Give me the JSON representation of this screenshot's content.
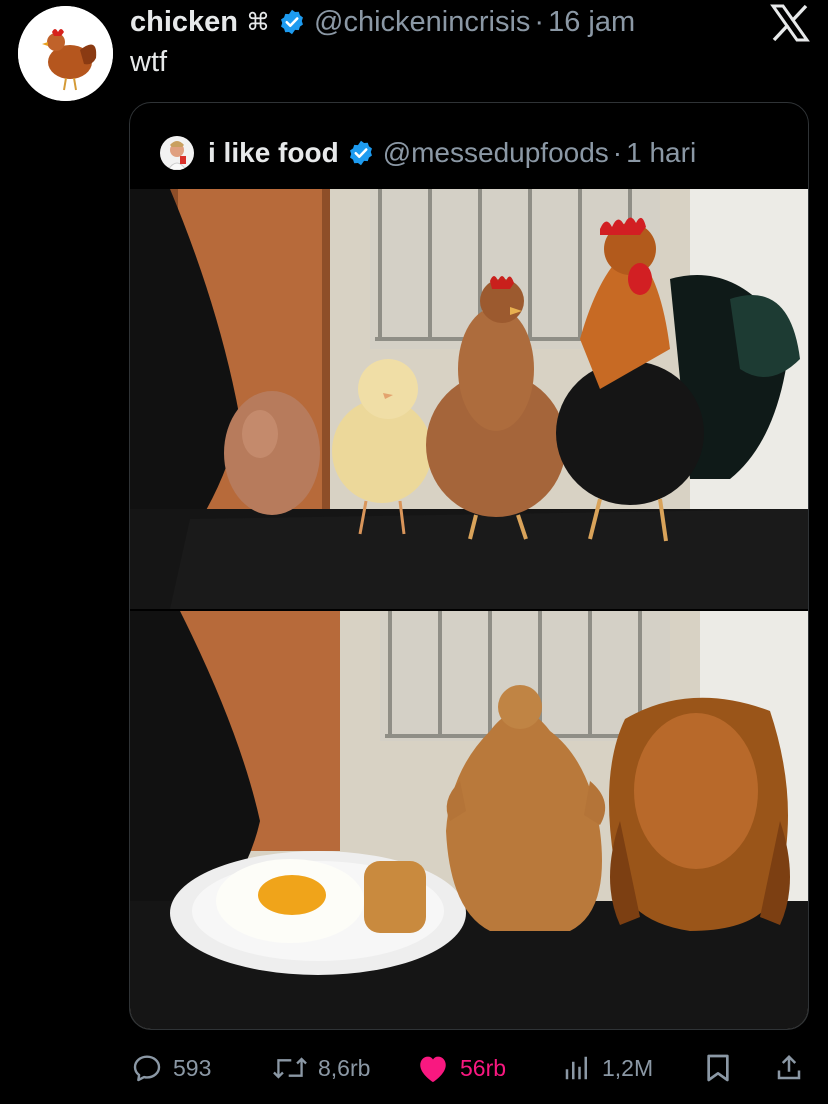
{
  "tweet": {
    "author_name": "chicken",
    "author_symbol": "⌘",
    "author_handle": "@chickenincrisis",
    "separator": "·",
    "time": "16 jam",
    "text": "wtf"
  },
  "quoted": {
    "author_name": "i like food",
    "author_handle": "@messedupfoods",
    "separator": "·",
    "time": "1 hari"
  },
  "actions": {
    "replies": "593",
    "reposts": "8,6rb",
    "likes": "56rb",
    "views": "1,2M"
  },
  "colors": {
    "background": "#000000",
    "text": "#e7e9ea",
    "secondary": "#8b98a5",
    "verified": "#1d9bf0",
    "like": "#f91880",
    "border": "#2f3336"
  },
  "icons": [
    "x-logo-icon",
    "verified-badge-icon",
    "reply-icon",
    "repost-icon",
    "like-icon",
    "views-icon",
    "bookmark-icon",
    "share-icon"
  ]
}
